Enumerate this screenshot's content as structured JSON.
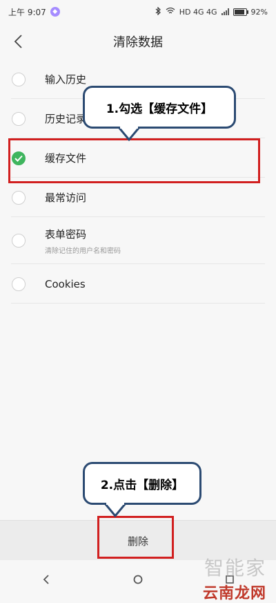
{
  "status": {
    "time": "上午 9:07",
    "right_text": "HD 4G 4G",
    "battery": "92%"
  },
  "header": {
    "title": "清除数据"
  },
  "items": [
    {
      "label": "输入历史",
      "checked": false,
      "sub": ""
    },
    {
      "label": "历史记录",
      "checked": false,
      "sub": ""
    },
    {
      "label": "缓存文件",
      "checked": true,
      "sub": ""
    },
    {
      "label": "最常访问",
      "checked": false,
      "sub": ""
    },
    {
      "label": "表单密码",
      "checked": false,
      "sub": "清除记住的用户名和密码"
    },
    {
      "label": "Cookies",
      "checked": false,
      "sub": ""
    }
  ],
  "annotations": {
    "step1": "1.勾选【缓存文件】",
    "step2": "2.点击【删除】"
  },
  "footer": {
    "delete_label": "删除"
  },
  "watermark": {
    "top": "智能家",
    "bottom": "云南龙网"
  },
  "colors": {
    "accent_green": "#3fb55e",
    "highlight_red": "#d11f1f",
    "callout_border": "#2b4a72"
  }
}
